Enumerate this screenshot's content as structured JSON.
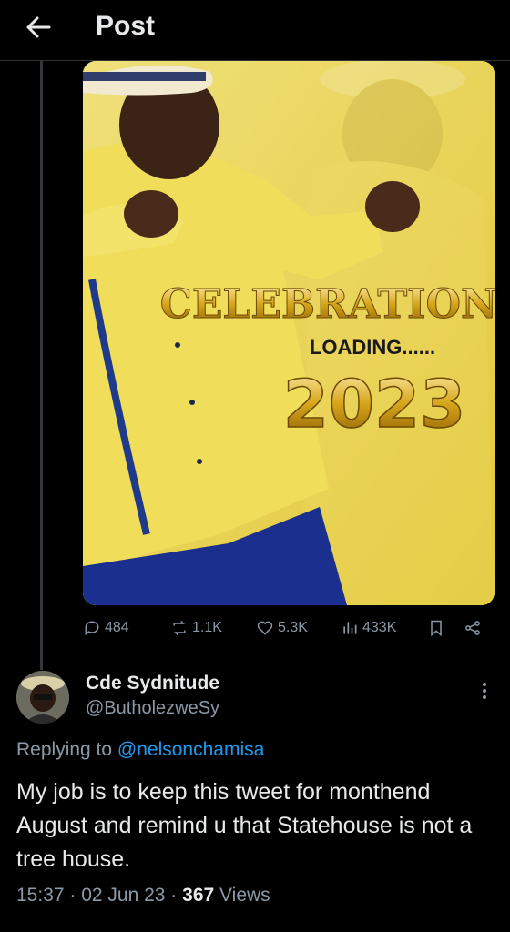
{
  "header": {
    "title": "Post"
  },
  "media": {
    "headline": "CELEBRATION",
    "subline": "LOADING......",
    "year": "2023"
  },
  "stats": {
    "replies": "484",
    "reposts": "1.1K",
    "likes": "5.3K",
    "views": "433K"
  },
  "reply_tweet": {
    "author_name": "Cde Sydnitude",
    "author_handle": "@ButholezweSy",
    "replying_prefix": "Replying to",
    "replying_to": "@nelsonchamisa",
    "text": "My job is to keep this tweet for monthend August and remind u that Statehouse is not a tree house.",
    "time": "15:37 · 02 Jun 23 ·",
    "views_count": "367",
    "views_label": "Views"
  },
  "colors": {
    "accent": "#1d9bf0",
    "muted": "#8b98a5",
    "background": "#000000"
  }
}
